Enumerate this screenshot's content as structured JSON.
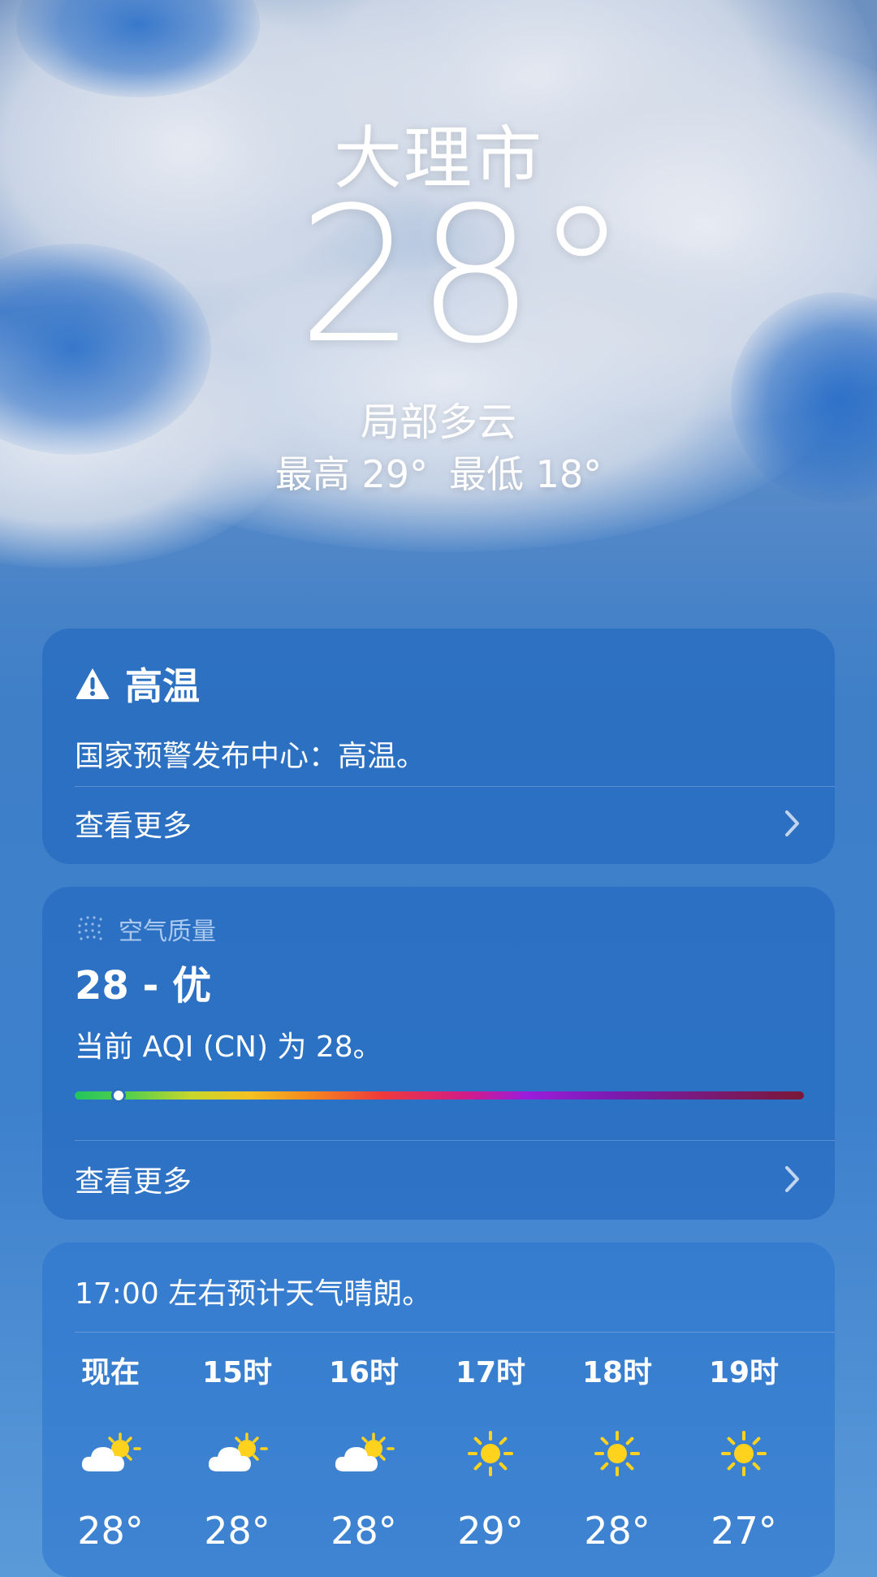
{
  "header": {
    "city": "大理市",
    "temperature": "28°",
    "condition": "局部多云",
    "high": "最高 29°",
    "low": "最低 18°"
  },
  "alert": {
    "icon": "warning-icon",
    "title": "高温",
    "description": "国家预警发布中心：高温。",
    "more_label": "查看更多"
  },
  "aqi": {
    "icon": "air-quality-dots-icon",
    "heading": "空气质量",
    "value": "28 - 优",
    "description": "当前 AQI (CN) 为 28。",
    "indicator_fraction": 0.06,
    "more_label": "查看更多"
  },
  "hourly": {
    "description": "17:00 左右预计天气晴朗。",
    "items": [
      {
        "label": "现在",
        "icon": "partly-cloudy-icon",
        "temp": "28°"
      },
      {
        "label": "15时",
        "icon": "partly-cloudy-icon",
        "temp": "28°"
      },
      {
        "label": "16时",
        "icon": "partly-cloudy-icon",
        "temp": "28°"
      },
      {
        "label": "17时",
        "icon": "sun-icon",
        "temp": "29°"
      },
      {
        "label": "18时",
        "icon": "sun-icon",
        "temp": "28°"
      },
      {
        "label": "19时",
        "icon": "sun-icon",
        "temp": "27°"
      }
    ]
  },
  "colors": {
    "card_bg": "#2a6fc0",
    "sun": "#ffd21e",
    "cloud": "#ffffff"
  }
}
